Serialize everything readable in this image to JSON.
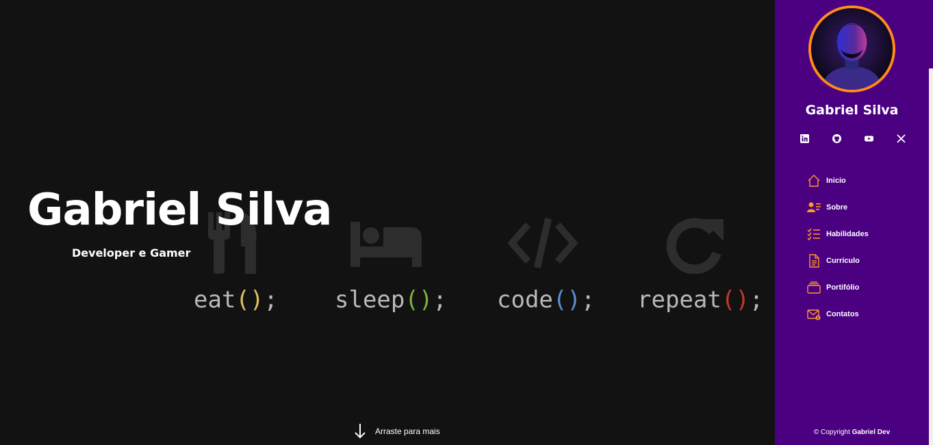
{
  "hero": {
    "title": "Gabriel Silva",
    "subtitle": "Developer e Gamer",
    "scroll_hint": "Arraste para mais",
    "motto": [
      {
        "word": "eat",
        "open": "(",
        "close": ")",
        "end": ";",
        "paren_color": "#e0c060",
        "icon": "fork-knife-icon"
      },
      {
        "word": "sleep",
        "open": "(",
        "close": ")",
        "end": ";",
        "paren_color": "#7cb342",
        "icon": "bed-icon"
      },
      {
        "word": "code",
        "open": "(",
        "close": ")",
        "end": ";",
        "paren_color": "#5b8fd8",
        "icon": "code-icon"
      },
      {
        "word": "repeat",
        "open": "(",
        "close": ")",
        "end": ";",
        "paren_color": "#c0392b",
        "icon": "redo-icon"
      }
    ]
  },
  "sidebar": {
    "name": "Gabriel Silva",
    "socials": [
      "linkedin-icon",
      "github-icon",
      "youtube-icon",
      "x-icon"
    ],
    "nav": [
      {
        "label": "Inicio",
        "icon": "home-icon"
      },
      {
        "label": "Sobre",
        "icon": "user-card-icon"
      },
      {
        "label": "Habilidades",
        "icon": "list-check-icon"
      },
      {
        "label": "Currículo",
        "icon": "document-icon"
      },
      {
        "label": "Portifólio",
        "icon": "folder-icon"
      },
      {
        "label": "Contatos",
        "icon": "mail-icon"
      }
    ],
    "copyright_prefix": "© Copyright",
    "copyright_name": "Gabriel Dev"
  },
  "colors": {
    "sidebar_bg": "#4b0082",
    "accent": "#ff8c1a",
    "page_bg": "#121212"
  }
}
